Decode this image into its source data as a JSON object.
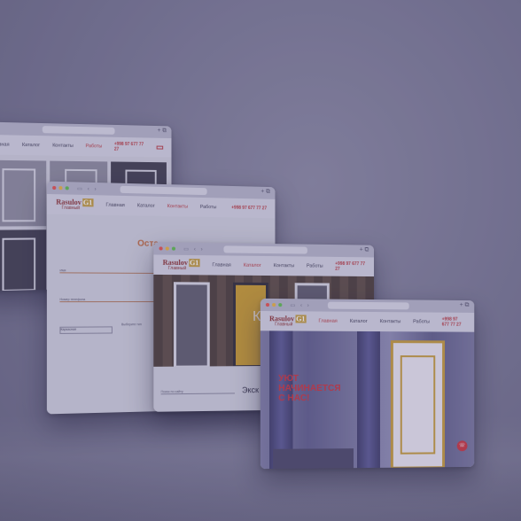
{
  "browser": {
    "url_text": "",
    "new_tab_icon": "plus-icon",
    "tabs_icon": "tabs-icon"
  },
  "brand": {
    "logo_primary": "Rasulov",
    "logo_badge": "G1",
    "logo_sub": "Главный"
  },
  "nav": {
    "home": "Главная",
    "catalog": "Каталог",
    "contacts": "Контакты",
    "works": "Работы",
    "phone": "+998 97 677 77 27",
    "button": ""
  },
  "window2": {
    "heading": "Оста",
    "field_name": "Имя",
    "field_phone": "Номер телефона",
    "select_value": "Каркасная",
    "select_label": "Выберите тип"
  },
  "window3": {
    "hero_text": "Ка",
    "search_placeholder": "Поиск по сайту",
    "exclusive": "Экск"
  },
  "window4": {
    "headline_line1": "УЮТ",
    "headline_line2": "НАЧИНАЕТСЯ",
    "headline_line3": "С НАС!"
  },
  "colors": {
    "accent": "#b7353a",
    "gold": "#c49a36",
    "background": "#75738d"
  }
}
